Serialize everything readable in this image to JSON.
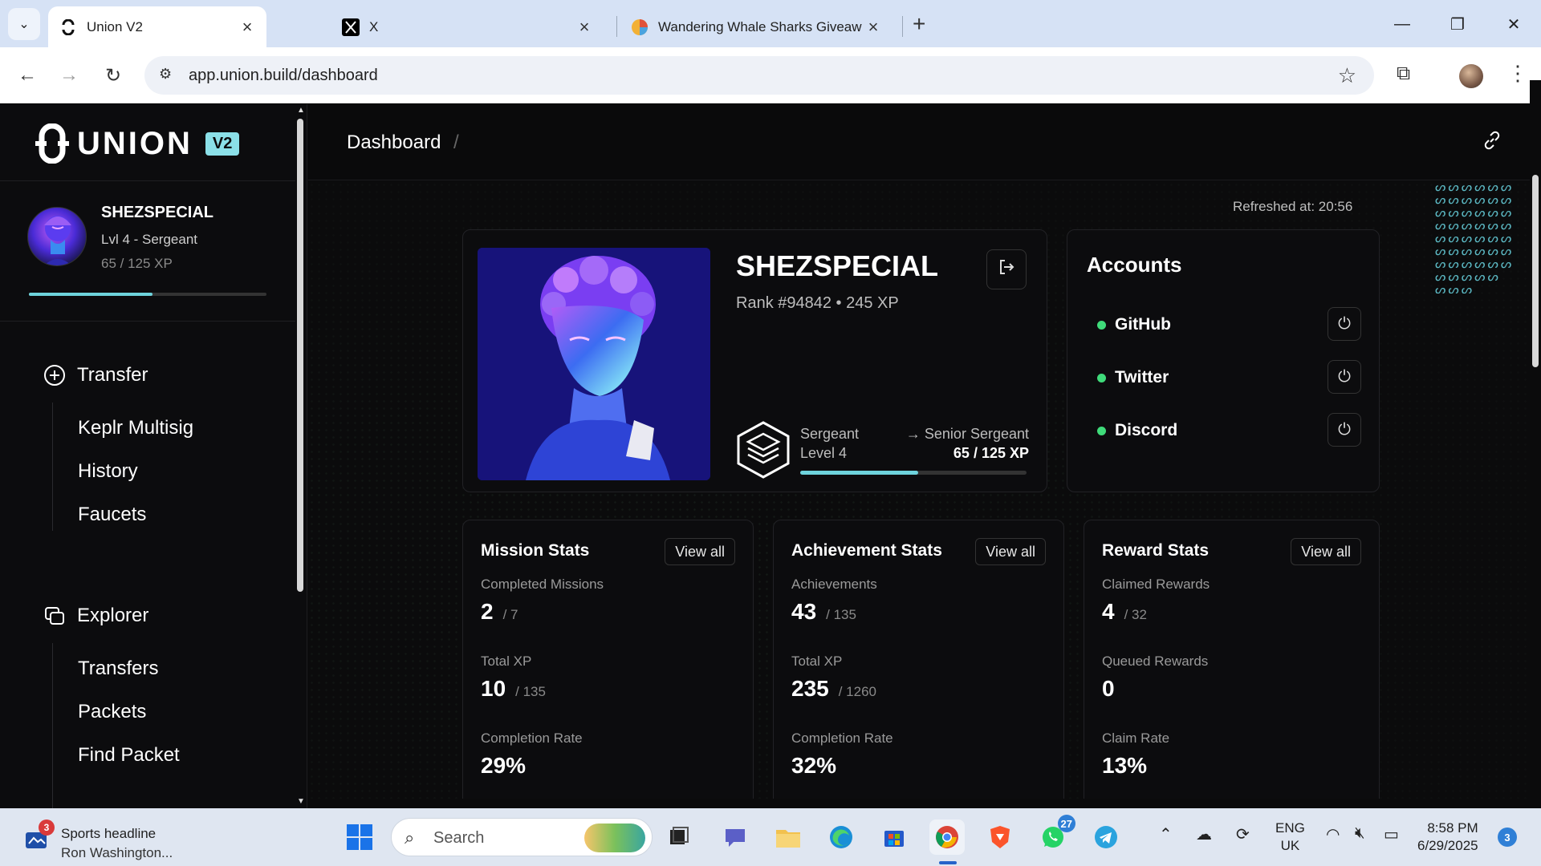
{
  "browser": {
    "tabs": [
      {
        "title": "Union V2"
      },
      {
        "title": "X"
      },
      {
        "title": "Wandering Whale Sharks Giveaw"
      }
    ],
    "url": "app.union.build/dashboard"
  },
  "sidebar": {
    "logo_text": "UNION",
    "logo_badge": "V2",
    "user": {
      "name": "SHEZSPECIAL",
      "level": "Lvl 4 - Sergeant",
      "xp": "65 / 125 XP",
      "progress_fraction": 0.52
    },
    "groups": [
      {
        "title": "Transfer",
        "items": [
          "Keplr Multisig",
          "History",
          "Faucets"
        ]
      },
      {
        "title": "Explorer",
        "items": [
          "Transfers",
          "Packets",
          "Find Packet"
        ]
      }
    ]
  },
  "topbar": {
    "breadcrumb": "Dashboard",
    "separator": "/"
  },
  "dashboard": {
    "refreshed": "Refreshed at: 20:56",
    "profile": {
      "name": "SHEZSPECIAL",
      "rank_line": "Rank #94842 • 245 XP",
      "rank_name": "Sergeant",
      "rank_level": "Level 4",
      "next_rank": "→ Senior Sergeant",
      "xp": "65 / 125 XP",
      "progress_fraction": 0.52
    },
    "accounts": {
      "title": "Accounts",
      "items": [
        {
          "name": "GitHub",
          "status_color": "#3fdb7a"
        },
        {
          "name": "Twitter",
          "status_color": "#3fdb7a"
        },
        {
          "name": "Discord",
          "status_color": "#3fdb7a"
        }
      ]
    },
    "stats": [
      {
        "title": "Mission Stats",
        "view_all": "View all",
        "rows": [
          {
            "label": "Completed Missions",
            "value": "2",
            "total": "/ 7"
          },
          {
            "label": "Total XP",
            "value": "10",
            "total": "/ 135"
          },
          {
            "label": "Completion Rate",
            "value": "29%",
            "total": ""
          }
        ]
      },
      {
        "title": "Achievement Stats",
        "view_all": "View all",
        "rows": [
          {
            "label": "Achievements",
            "value": "43",
            "total": "/ 135"
          },
          {
            "label": "Total XP",
            "value": "235",
            "total": "/ 1260"
          },
          {
            "label": "Completion Rate",
            "value": "32%",
            "total": ""
          }
        ]
      },
      {
        "title": "Reward Stats",
        "view_all": "View all",
        "rows": [
          {
            "label": "Claimed Rewards",
            "value": "4",
            "total": "/ 32"
          },
          {
            "label": "Queued Rewards",
            "value": "0",
            "total": ""
          },
          {
            "label": "Claim Rate",
            "value": "13%",
            "total": ""
          }
        ]
      }
    ]
  },
  "taskbar": {
    "news_badge": "3",
    "news_title": "Sports headline",
    "news_subtitle": "Ron Washington...",
    "search_placeholder": "Search",
    "whatsapp_badge": "27",
    "lang_line1": "ENG",
    "lang_line2": "UK",
    "time": "8:58 PM",
    "date": "6/29/2025",
    "notifications": "3"
  },
  "colors": {
    "accent": "#6ed3dc",
    "online": "#3fdb7a",
    "background": "#0b0b0c"
  }
}
